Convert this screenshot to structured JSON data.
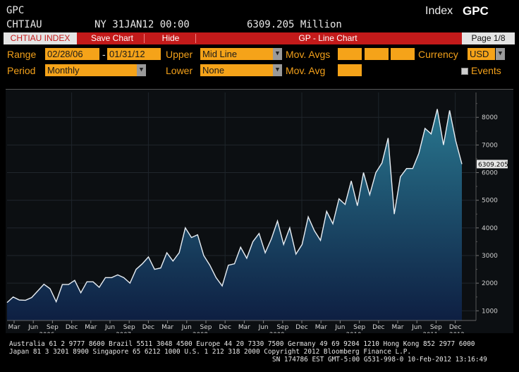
{
  "header": {
    "ticker": "GPC",
    "index_code": "CHTIAU",
    "exchange_date": "NY 31JAN12 00:00",
    "value": "6309.205 Million",
    "index_label": "Index",
    "index_ticker": "GPC"
  },
  "toolbar": {
    "security_tab": "CHTIAU INDEX",
    "save_chart": "Save Chart",
    "hide": "Hide",
    "title": "GP - Line Chart",
    "page": "Page 1/8"
  },
  "controls": {
    "range_label": "Range",
    "range_start": "02/28/06",
    "range_sep": "-",
    "range_end": "01/31/12",
    "upper_label": "Upper",
    "upper_value": "Mid Line",
    "mov_avgs_label": "Mov. Avgs",
    "currency_label": "Currency",
    "currency_value": "USD",
    "period_label": "Period",
    "period_value": "Monthly",
    "lower_label": "Lower",
    "lower_value": "None",
    "mov_avg_label": "Mov. Avg",
    "events_label": "Events"
  },
  "chart_data": {
    "type": "area",
    "series": [
      {
        "values": [
          1300,
          1500,
          1390,
          1380,
          1480,
          1720,
          1960,
          1800,
          1330,
          1950,
          1950,
          2100,
          1650,
          2050,
          2050,
          1850,
          2200,
          2200,
          2300,
          2200,
          2000,
          2500,
          2700,
          2950,
          2500,
          2550,
          3100,
          2800,
          3100,
          4000,
          3650,
          3750,
          3000,
          2650,
          2200,
          1900,
          2650,
          2700,
          3300,
          2900,
          3500,
          3800,
          3100,
          3600,
          4250,
          3400,
          4000,
          3050,
          3400,
          4400,
          3900,
          3550,
          4600,
          4150,
          5050,
          4850,
          5700,
          4800,
          6000,
          5200,
          6000,
          6350,
          7250,
          4500,
          5850,
          6150,
          6150,
          6700,
          7600,
          7400,
          8300,
          7000,
          8250,
          7150,
          6309
        ]
      }
    ],
    "x_tick_labels": [
      "Mar",
      "Jun",
      "Sep",
      "Dec",
      "Mar",
      "Jun",
      "Sep",
      "Dec",
      "Mar",
      "Jun",
      "Sep",
      "Dec",
      "Mar",
      "Jun",
      "Sep",
      "Dec",
      "Mar",
      "Jun",
      "Sep",
      "Dec",
      "Mar",
      "Jun",
      "Sep",
      "Dec"
    ],
    "year_labels": [
      "2006",
      "2007",
      "2008",
      "2009",
      "2010",
      "2011",
      "2012"
    ],
    "y_tick_labels": [
      "1000",
      "2000",
      "3000",
      "4000",
      "5000",
      "6000",
      "7000",
      "8000"
    ],
    "ylim": [
      650,
      8900
    ],
    "last_value_label": "6309.205",
    "area_color_top": "#29778f",
    "area_color_bottom": "#0e1f42",
    "line_color": "#e8eef4",
    "grid": true
  },
  "footer": {
    "line1": "Australia 61 2 9777 8600 Brazil 5511 3048 4500 Europe 44 20 7330 7500 Germany 49 69 9204 1210 Hong Kong 852 2977 6000",
    "line2": "Japan 81 3 3201 8900         Singapore 65 6212 1000          U.S. 1 212 318 2000         Copyright 2012 Bloomberg Finance L.P.",
    "line3": "SN 174786 EST  GMT-5:00 G531-998-0 10-Feb-2012 13:16:49"
  }
}
